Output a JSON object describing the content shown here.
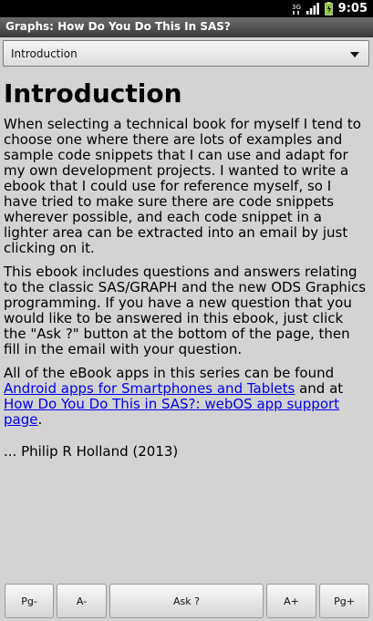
{
  "status_bar": {
    "time": "9:05",
    "icons": [
      "network-3g-icon",
      "signal-icon",
      "battery-icon"
    ]
  },
  "app": {
    "title": "Graphs: How Do You Do This In SAS?"
  },
  "section_select": {
    "selected": "Introduction"
  },
  "article": {
    "heading": "Introduction",
    "para1": "When selecting a technical book for myself I tend to choose one where there are lots of examples and sample code snippets that I can use and adapt for my own development projects. I wanted to write a ebook that I could use for reference myself, so I have tried to make sure there are code snippets wherever possible, and each code snippet in a lighter area can be extracted into an email by just clicking on it.",
    "para2": "This ebook includes questions and answers relating to the classic SAS/GRAPH and the new ODS Graphics programming. If you have a new question that you would like to be answered in this ebook, just click the \"Ask ?\" button at the bottom of the page, then fill in the email with your question.",
    "para3_prefix": "All of the eBook apps in this series can be found ",
    "link1": "Android apps for Smartphones and Tablets",
    "para3_mid": " and at ",
    "link2": "How Do You Do This in SAS?: webOS app support page",
    "para3_suffix": ".",
    "signature": "... Philip R Holland (2013)"
  },
  "toolbar": {
    "prev_page": "Pg-",
    "font_smaller": "A-",
    "ask": "Ask ?",
    "font_larger": "A+",
    "next_page": "Pg+"
  },
  "colors": {
    "background": "#d3d3d3",
    "link": "#0000ee"
  }
}
